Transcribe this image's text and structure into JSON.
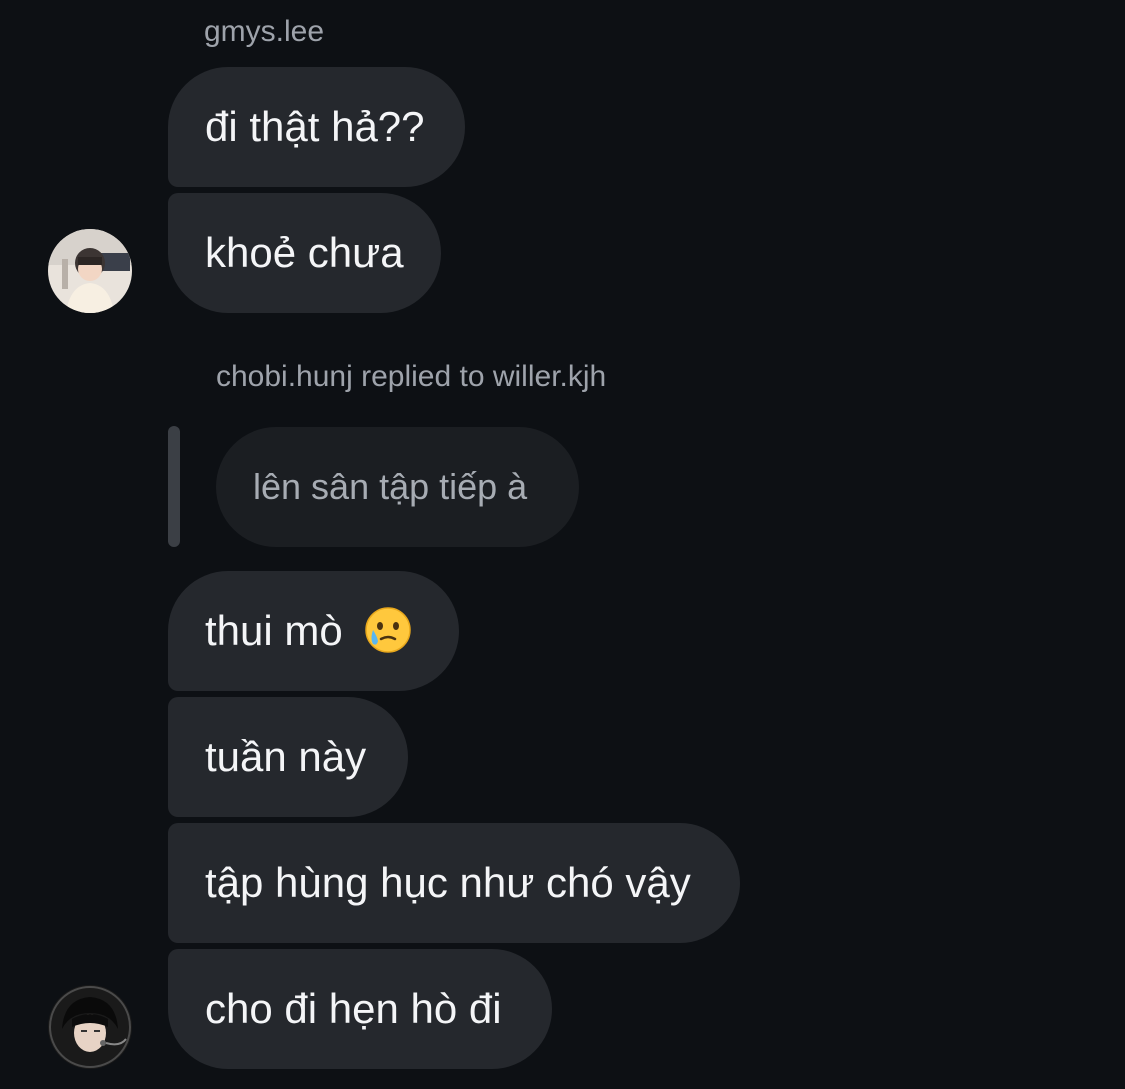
{
  "conversation": {
    "group1": {
      "sender": "gmys.lee",
      "messages": [
        "đi thật hả??",
        "khoẻ chưa"
      ]
    },
    "reply": {
      "header": "chobi.hunj replied to willer.kjh",
      "quoted_text": "lên sân tập tiếp à"
    },
    "group2": {
      "messages": [
        "thui mò",
        "tuần này",
        "tập hùng hục như chó vậy",
        "cho đi hẹn hò đi"
      ],
      "emoji": "face-holding-back-tears"
    }
  },
  "colors": {
    "background": "#0d1014",
    "bubble": "#25282d",
    "reply_bubble": "#1b1e22",
    "secondary_text": "#9ea3ab"
  }
}
